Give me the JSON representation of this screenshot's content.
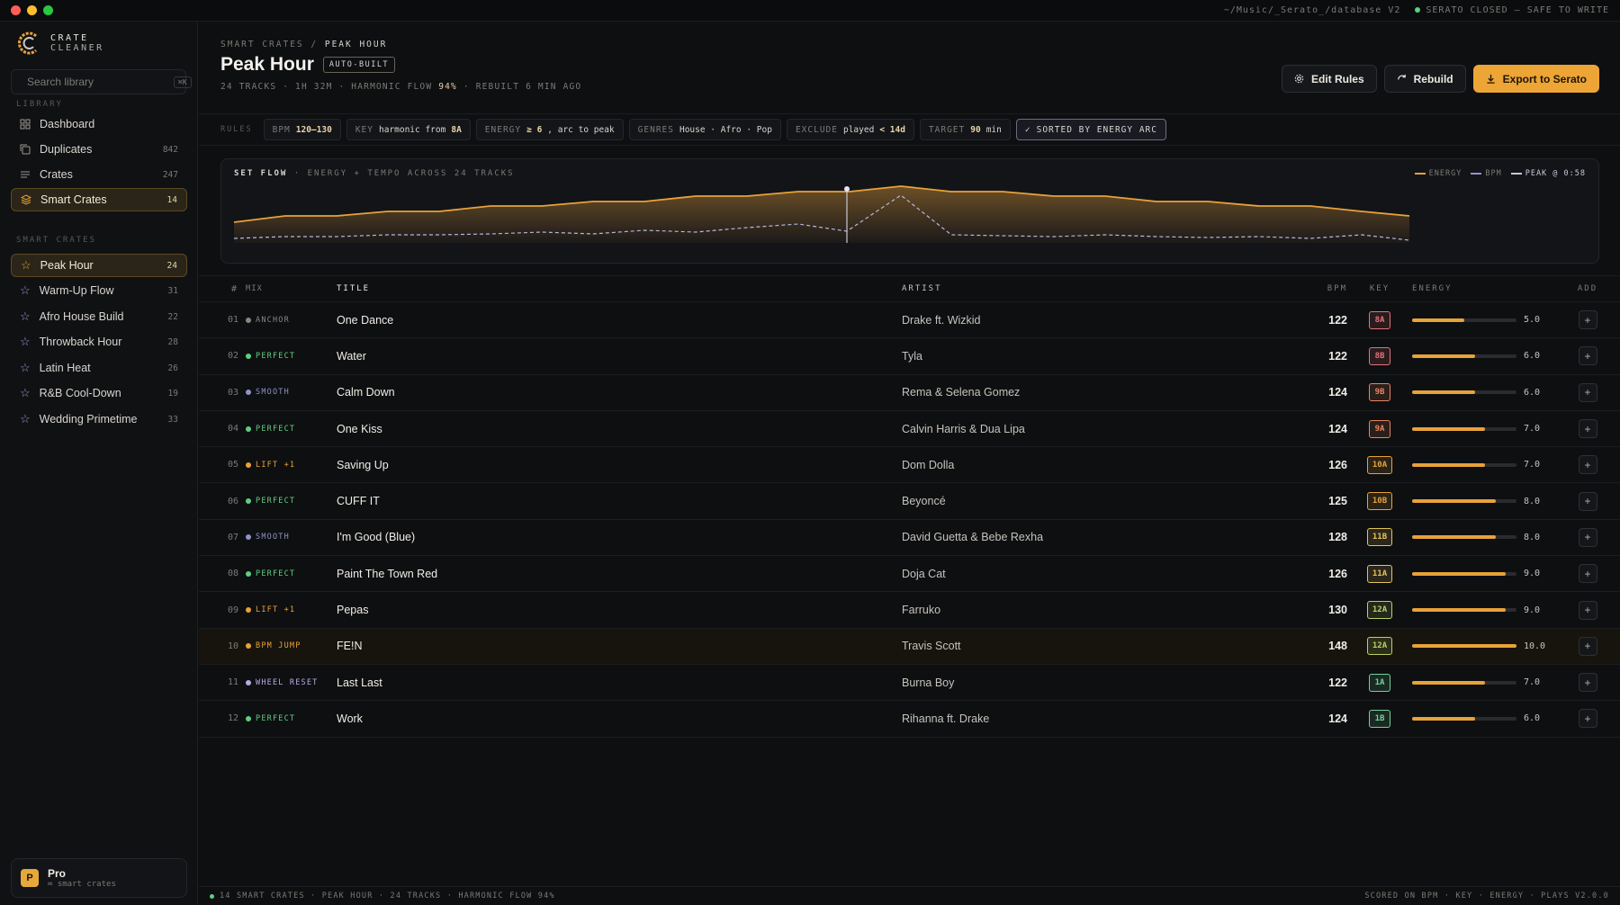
{
  "titlebar": {
    "path": "~/Music/_Serato_/database V2",
    "status": "SERATO CLOSED — SAFE TO WRITE"
  },
  "brand": {
    "line1": "CRATE",
    "line2": "CLEANER"
  },
  "search": {
    "placeholder": "Search library",
    "shortcut": "⌘K"
  },
  "library": {
    "label": "LIBRARY",
    "items": [
      {
        "label": "Dashboard",
        "count": "",
        "icon": "grid-icon"
      },
      {
        "label": "Duplicates",
        "count": "842",
        "icon": "copy-icon"
      },
      {
        "label": "Crates",
        "count": "247",
        "icon": "list-icon"
      },
      {
        "label": "Smart Crates",
        "count": "14",
        "icon": "layers-icon"
      }
    ]
  },
  "smart_crates": {
    "label": "SMART CRATES",
    "items": [
      {
        "label": "Peak Hour",
        "count": "24"
      },
      {
        "label": "Warm-Up Flow",
        "count": "31"
      },
      {
        "label": "Afro House Build",
        "count": "22"
      },
      {
        "label": "Throwback Hour",
        "count": "28"
      },
      {
        "label": "Latin Heat",
        "count": "26"
      },
      {
        "label": "R&B Cool-Down",
        "count": "19"
      },
      {
        "label": "Wedding Primetime",
        "count": "33"
      }
    ]
  },
  "pro": {
    "badge": "P",
    "title": "Pro",
    "subtitle": "∞ smart crates"
  },
  "header": {
    "crumb_root": "SMART CRATES",
    "crumb_sep": "/",
    "crumb_current": "PEAK HOUR",
    "title": "Peak Hour",
    "badge": "AUTO-BUILT",
    "meta_prefix": "24 TRACKS · 1H 32M · HARMONIC FLOW",
    "meta_flow": "94%",
    "meta_suffix": "· REBUILT 6 MIN AGO"
  },
  "actions": {
    "edit": "Edit Rules",
    "rebuild": "Rebuild",
    "export": "Export to Serato"
  },
  "rules": {
    "label": "RULES",
    "chips": [
      {
        "k": "BPM",
        "v": "120–130"
      },
      {
        "k": "KEY",
        "t": "harmonic from",
        "v": "8A"
      },
      {
        "k": "ENERGY",
        "v": "≥ 6",
        "t2": ", arc to peak"
      },
      {
        "k": "GENRES",
        "t": "House · Afro · Pop"
      },
      {
        "k": "EXCLUDE",
        "t": "played",
        "v": "< 14d"
      },
      {
        "k": "TARGET",
        "v": "90",
        "t2": "min"
      }
    ],
    "sorted": "SORTED BY ENERGY ARC"
  },
  "flow": {
    "title": "SET FLOW",
    "subtitle": "· ENERGY + TEMPO ACROSS 24 TRACKS",
    "legend": {
      "energy": "ENERGY",
      "bpm": "BPM",
      "peak": "PEAK @ 0:58"
    },
    "colors": {
      "energy": "#e8a23a",
      "bpm": "#8f93c9",
      "peak": "#c9c7d6"
    }
  },
  "table": {
    "headers": {
      "num": "#",
      "mix": "MIX",
      "title": "TITLE",
      "artist": "ARTIST",
      "bpm": "BPM",
      "key": "KEY",
      "energy": "ENERGY",
      "add": "ADD"
    },
    "rows": [
      {
        "num": "01",
        "mix": "ANCHOR",
        "mixColor": "#8a877f",
        "title": "One Dance",
        "artist": "Drake ft. Wizkid",
        "bpm": "122",
        "key": "8A",
        "keyColor": "#e2737a",
        "energy": "5.0",
        "energyLevel": 5
      },
      {
        "num": "02",
        "mix": "PERFECT",
        "mixColor": "#5fcf80",
        "title": "Water",
        "artist": "Tyla",
        "bpm": "122",
        "key": "8B",
        "keyColor": "#e2737a",
        "energy": "6.0",
        "energyLevel": 6
      },
      {
        "num": "03",
        "mix": "SMOOTH",
        "mixColor": "#8f93c9",
        "title": "Calm Down",
        "artist": "Rema & Selena Gomez",
        "bpm": "124",
        "key": "9B",
        "keyColor": "#e88462",
        "energy": "6.0",
        "energyLevel": 6
      },
      {
        "num": "04",
        "mix": "PERFECT",
        "mixColor": "#5fcf80",
        "title": "One Kiss",
        "artist": "Calvin Harris & Dua Lipa",
        "bpm": "124",
        "key": "9A",
        "keyColor": "#e88462",
        "energy": "7.0",
        "energyLevel": 7
      },
      {
        "num": "05",
        "mix": "LIFT +1",
        "mixColor": "#e8a23a",
        "title": "Saving Up",
        "artist": "Dom Dolla",
        "bpm": "126",
        "key": "10A",
        "keyColor": "#e8a23a",
        "energy": "7.0",
        "energyLevel": 7
      },
      {
        "num": "06",
        "mix": "PERFECT",
        "mixColor": "#5fcf80",
        "title": "CUFF IT",
        "artist": "Beyoncé",
        "bpm": "125",
        "key": "10B",
        "keyColor": "#e8a23a",
        "energy": "8.0",
        "energyLevel": 8
      },
      {
        "num": "07",
        "mix": "SMOOTH",
        "mixColor": "#8f93c9",
        "title": "I'm Good (Blue)",
        "artist": "David Guetta & Bebe Rexha",
        "bpm": "128",
        "key": "11B",
        "keyColor": "#e6c35a",
        "energy": "8.0",
        "energyLevel": 8
      },
      {
        "num": "08",
        "mix": "PERFECT",
        "mixColor": "#5fcf80",
        "title": "Paint The Town Red",
        "artist": "Doja Cat",
        "bpm": "126",
        "key": "11A",
        "keyColor": "#e6c35a",
        "energy": "9.0",
        "energyLevel": 9
      },
      {
        "num": "09",
        "mix": "LIFT +1",
        "mixColor": "#e8a23a",
        "title": "Pepas",
        "artist": "Farruko",
        "bpm": "130",
        "key": "12A",
        "keyColor": "#b8d266",
        "energy": "9.0",
        "energyLevel": 9
      },
      {
        "num": "10",
        "mix": "BPM JUMP",
        "mixColor": "#e8a23a",
        "title": "FE!N",
        "artist": "Travis Scott",
        "bpm": "148",
        "key": "12A",
        "keyColor": "#b8d266",
        "energy": "10.0",
        "energyLevel": 10,
        "hot": true
      },
      {
        "num": "11",
        "mix": "WHEEL RESET",
        "mixColor": "#b9a8e6",
        "title": "Last Last",
        "artist": "Burna Boy",
        "bpm": "122",
        "key": "1A",
        "keyColor": "#6fd39a",
        "energy": "7.0",
        "energyLevel": 7
      },
      {
        "num": "12",
        "mix": "PERFECT",
        "mixColor": "#5fcf80",
        "title": "Work",
        "artist": "Rihanna ft. Drake",
        "bpm": "124",
        "key": "1B",
        "keyColor": "#6fd39a",
        "energy": "6.0",
        "energyLevel": 6
      }
    ]
  },
  "statusbar": {
    "left": "14 SMART CRATES · PEAK HOUR · 24 TRACKS · HARMONIC FLOW 94%",
    "right": "SCORED ON BPM · KEY · ENERGY · PLAYS   V2.0.0"
  }
}
